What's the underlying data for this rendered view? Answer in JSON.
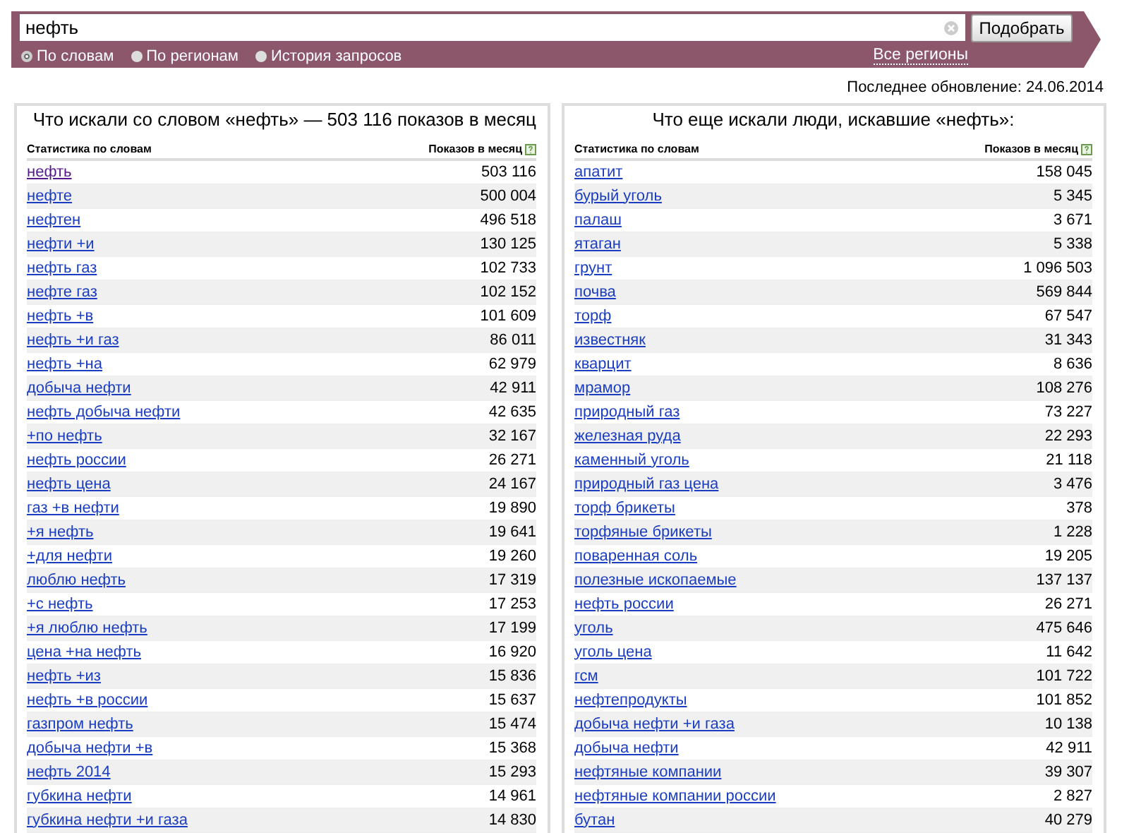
{
  "search": {
    "value": "нефть",
    "button": "Подобрать"
  },
  "modes": [
    {
      "label": "По словам",
      "selected": true
    },
    {
      "label": "По регионам",
      "selected": false
    },
    {
      "label": "История запросов",
      "selected": false
    }
  ],
  "regions_link": "Все регионы",
  "last_update": "Последнее обновление: 24.06.2014",
  "panels": [
    {
      "title": "Что искали со словом «нефть» — 503 116 показов в месяц",
      "col_word": "Статистика по словам",
      "col_count": "Показов в месяц",
      "rows": [
        {
          "word": "нефть",
          "count": "503 116",
          "visited": true
        },
        {
          "word": "нефте",
          "count": "500 004",
          "visited": false
        },
        {
          "word": "нефтен",
          "count": "496 518",
          "visited": false
        },
        {
          "word": "нефти +и",
          "count": "130 125",
          "visited": false
        },
        {
          "word": "нефть газ",
          "count": "102 733",
          "visited": false
        },
        {
          "word": "нефте газ",
          "count": "102 152",
          "visited": false
        },
        {
          "word": "нефть +в",
          "count": "101 609",
          "visited": false
        },
        {
          "word": "нефть +и газ",
          "count": "86 011",
          "visited": false
        },
        {
          "word": "нефть +на",
          "count": "62 979",
          "visited": false
        },
        {
          "word": "добыча нефти",
          "count": "42 911",
          "visited": false
        },
        {
          "word": "нефть добыча нефти",
          "count": "42 635",
          "visited": false
        },
        {
          "word": "+по нефть",
          "count": "32 167",
          "visited": false
        },
        {
          "word": "нефть россии",
          "count": "26 271",
          "visited": false
        },
        {
          "word": "нефть цена",
          "count": "24 167",
          "visited": false
        },
        {
          "word": "газ +в нефти",
          "count": "19 890",
          "visited": false
        },
        {
          "word": "+я нефть",
          "count": "19 641",
          "visited": false
        },
        {
          "word": "+для нефти",
          "count": "19 260",
          "visited": false
        },
        {
          "word": "люблю нефть",
          "count": "17 319",
          "visited": false
        },
        {
          "word": "+с нефть",
          "count": "17 253",
          "visited": false
        },
        {
          "word": "+я люблю нефть",
          "count": "17 199",
          "visited": false
        },
        {
          "word": "цена +на нефть",
          "count": "16 920",
          "visited": false
        },
        {
          "word": "нефть +из",
          "count": "15 836",
          "visited": false
        },
        {
          "word": "нефть +в россии",
          "count": "15 637",
          "visited": false
        },
        {
          "word": "газпром нефть",
          "count": "15 474",
          "visited": false
        },
        {
          "word": "добыча нефти +в",
          "count": "15 368",
          "visited": false
        },
        {
          "word": "нефть 2014",
          "count": "15 293",
          "visited": false
        },
        {
          "word": "губкина нефти",
          "count": "14 961",
          "visited": false
        },
        {
          "word": "губкина нефти +и газа",
          "count": "14 830",
          "visited": false
        }
      ]
    },
    {
      "title": "Что еще искали люди, искавшие «нефть»:",
      "col_word": "Статистика по словам",
      "col_count": "Показов в месяц",
      "rows": [
        {
          "word": "апатит",
          "count": "158 045",
          "visited": false
        },
        {
          "word": "бурый уголь",
          "count": "5 345",
          "visited": false
        },
        {
          "word": "палаш",
          "count": "3 671",
          "visited": false
        },
        {
          "word": "ятаган",
          "count": "5 338",
          "visited": false
        },
        {
          "word": "грунт",
          "count": "1 096 503",
          "visited": false
        },
        {
          "word": "почва",
          "count": "569 844",
          "visited": false
        },
        {
          "word": "торф",
          "count": "67 547",
          "visited": false
        },
        {
          "word": "известняк",
          "count": "31 343",
          "visited": false
        },
        {
          "word": "кварцит",
          "count": "8 636",
          "visited": false
        },
        {
          "word": "мрамор",
          "count": "108 276",
          "visited": false
        },
        {
          "word": "природный газ",
          "count": "73 227",
          "visited": false
        },
        {
          "word": "железная руда",
          "count": "22 293",
          "visited": false
        },
        {
          "word": "каменный уголь",
          "count": "21 118",
          "visited": false
        },
        {
          "word": "природный газ цена",
          "count": "3 476",
          "visited": false
        },
        {
          "word": "торф брикеты",
          "count": "378",
          "visited": false
        },
        {
          "word": "торфяные брикеты",
          "count": "1 228",
          "visited": false
        },
        {
          "word": "поваренная соль",
          "count": "19 205",
          "visited": false
        },
        {
          "word": "полезные ископаемые",
          "count": "137 137",
          "visited": false
        },
        {
          "word": "нефть россии",
          "count": "26 271",
          "visited": false
        },
        {
          "word": "уголь",
          "count": "475 646",
          "visited": false
        },
        {
          "word": "уголь цена",
          "count": "11 642",
          "visited": false
        },
        {
          "word": "гсм",
          "count": "101 722",
          "visited": false
        },
        {
          "word": "нефтепродукты",
          "count": "101 852",
          "visited": false
        },
        {
          "word": "добыча нефти +и газа",
          "count": "10 138",
          "visited": false
        },
        {
          "word": "добыча нефти",
          "count": "42 911",
          "visited": false
        },
        {
          "word": "нефтяные компании",
          "count": "39 307",
          "visited": false
        },
        {
          "word": "нефтяные компании россии",
          "count": "2 827",
          "visited": false
        },
        {
          "word": "бутан",
          "count": "40 279",
          "visited": false
        }
      ]
    }
  ]
}
